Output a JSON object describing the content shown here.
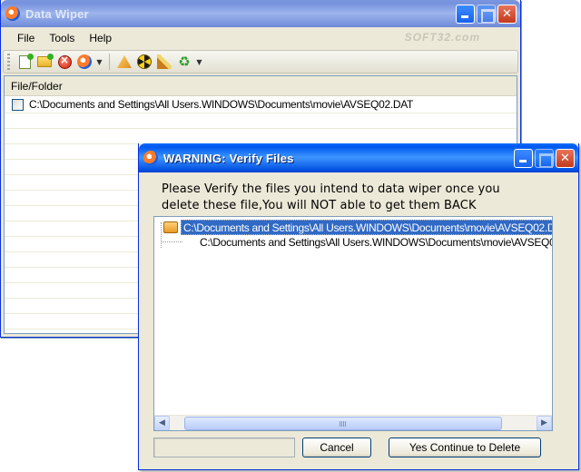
{
  "main_window": {
    "title": "Data Wiper",
    "menu": [
      "File",
      "Tools",
      "Help"
    ],
    "watermark": "SOFT32.com",
    "toolbar": {
      "icons": [
        "add-file-icon",
        "add-folder-icon",
        "stop-icon",
        "wipe-icon",
        "erase-icon",
        "nuke-icon",
        "brush-icon",
        "recycle-icon"
      ]
    },
    "list": {
      "column_header": "File/Folder",
      "rows": [
        "C:\\Documents and Settings\\All Users.WINDOWS\\Documents\\movie\\AVSEQ02.DAT"
      ]
    }
  },
  "dialog": {
    "title": "WARNING: Verify Files",
    "message_line1": "Please Verify the files you intend to data wiper once you",
    "message_line2": "delete these file,You will NOT able to get them BACK",
    "tree": {
      "root_label": "C:\\Documents and Settings\\All Users.WINDOWS\\Documents\\movie\\AVSEQ02.D",
      "child_label": "C:\\Documents and Settings\\All Users.WINDOWS\\Documents\\movie\\AVSEQ0"
    },
    "buttons": {
      "cancel": "Cancel",
      "continue": "Yes Continue to Delete"
    },
    "scroll_arrows": {
      "left": "◀",
      "right": "▶"
    }
  },
  "colors": {
    "titlebar_blue": "#0058ee",
    "selection": "#316ac5",
    "window_bg": "#ece9d8",
    "close_red": "#c4391c"
  }
}
